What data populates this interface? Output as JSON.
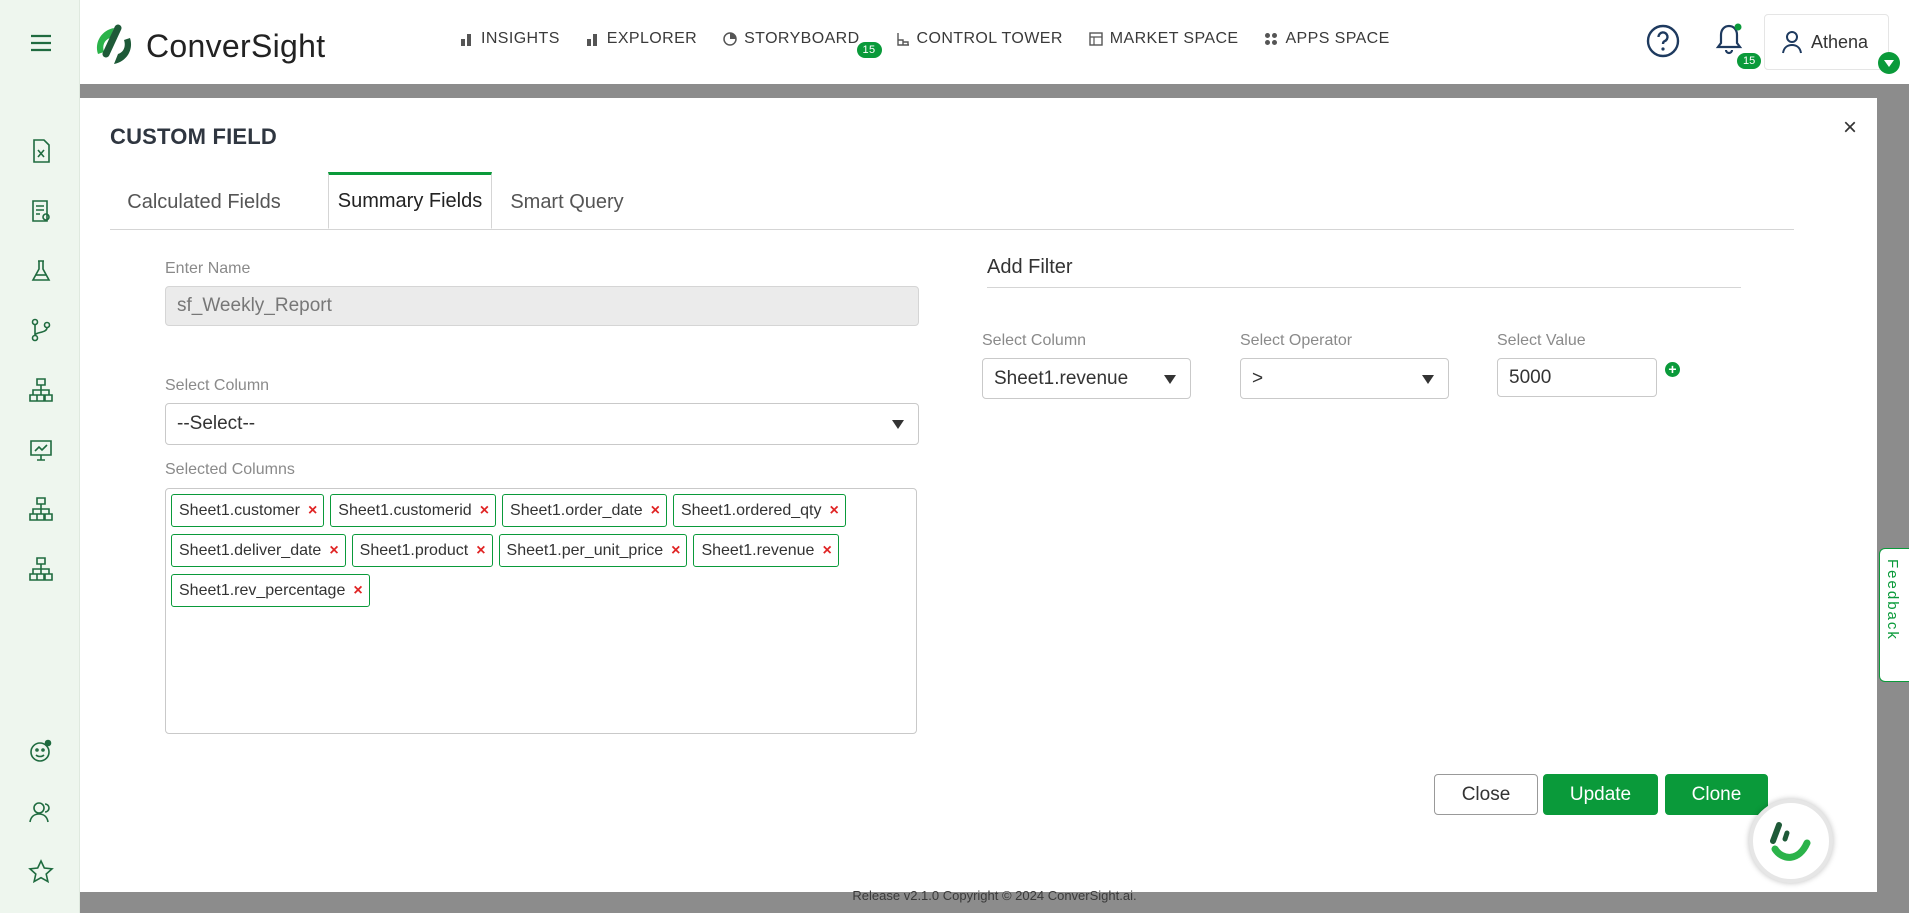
{
  "topbar": {
    "brand": "ConverSight",
    "nav": [
      {
        "label": "INSIGHTS",
        "icon": "bar-chart-icon"
      },
      {
        "label": "EXPLORER",
        "icon": "bar-chart-icon"
      },
      {
        "label": "STORYBOARD",
        "icon": "pie-chart-icon",
        "badge": "15"
      },
      {
        "label": "CONTROL TOWER",
        "icon": "tower-icon"
      },
      {
        "label": "MARKET SPACE",
        "icon": "market-icon"
      },
      {
        "label": "APPS SPACE",
        "icon": "apps-grid-icon"
      }
    ],
    "notification_count": "15",
    "user_name": "Athena"
  },
  "modal": {
    "title": "CUSTOM FIELD",
    "tabs": [
      "Calculated Fields",
      "Summary Fields",
      "Smart Query"
    ],
    "active_tab": "Summary Fields",
    "name_label": "Enter Name",
    "name_value": "sf_Weekly_Report",
    "select_column_label": "Select Column",
    "select_column_value": "--Select--",
    "selected_columns_label": "Selected Columns",
    "selected_columns": [
      "Sheet1.customer",
      "Sheet1.customerid",
      "Sheet1.order_date",
      "Sheet1.ordered_qty",
      "Sheet1.deliver_date",
      "Sheet1.product",
      "Sheet1.per_unit_price",
      "Sheet1.revenue",
      "Sheet1.rev_percentage"
    ],
    "chip_remove": "×",
    "filter": {
      "title": "Add Filter",
      "column_label": "Select Column",
      "column_value": "Sheet1.revenue",
      "operator_label": "Select Operator",
      "operator_value": ">",
      "value_label": "Select Value",
      "value": "5000",
      "add": "+"
    },
    "buttons": {
      "close": "Close",
      "update": "Update",
      "clone": "Clone"
    },
    "close_glyph": "×"
  },
  "feedback_label": "Feedback",
  "footer": "Release v2.1.0 Copyright © 2024 ConverSight.ai.",
  "colors": {
    "accent": "#0a9a3a",
    "remove": "#e02424",
    "sidebar": "#eef6ee"
  }
}
